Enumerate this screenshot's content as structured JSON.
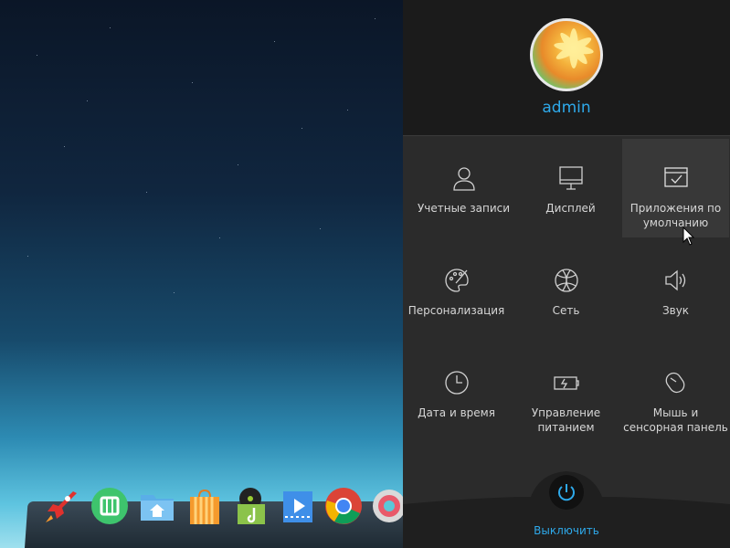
{
  "user": {
    "name": "admin"
  },
  "settings": [
    {
      "label": "Учетные записи",
      "icon": "user-icon"
    },
    {
      "label": "Дисплей",
      "icon": "monitor-icon"
    },
    {
      "label": "Приложения по умолчанию",
      "icon": "default-apps-icon"
    },
    {
      "label": "Персонализация",
      "icon": "palette-icon"
    },
    {
      "label": "Сеть",
      "icon": "globe-icon"
    },
    {
      "label": "Звук",
      "icon": "speaker-icon"
    },
    {
      "label": "Дата и время",
      "icon": "clock-icon"
    },
    {
      "label": "Управление питанием",
      "icon": "battery-icon"
    },
    {
      "label": "Мышь и сенсорная панель",
      "icon": "mouse-icon"
    }
  ],
  "power": {
    "label": "Выключить"
  },
  "dock": [
    "launcher-rocket-icon",
    "appstore-icon",
    "file-manager-icon",
    "store-bag-icon",
    "music-icon",
    "video-icon",
    "chrome-icon",
    "settings-gear-icon"
  ],
  "colors": {
    "accent": "#2ea9ea",
    "panel": "#2b2b2b",
    "panel_header": "#1b1b1b"
  }
}
